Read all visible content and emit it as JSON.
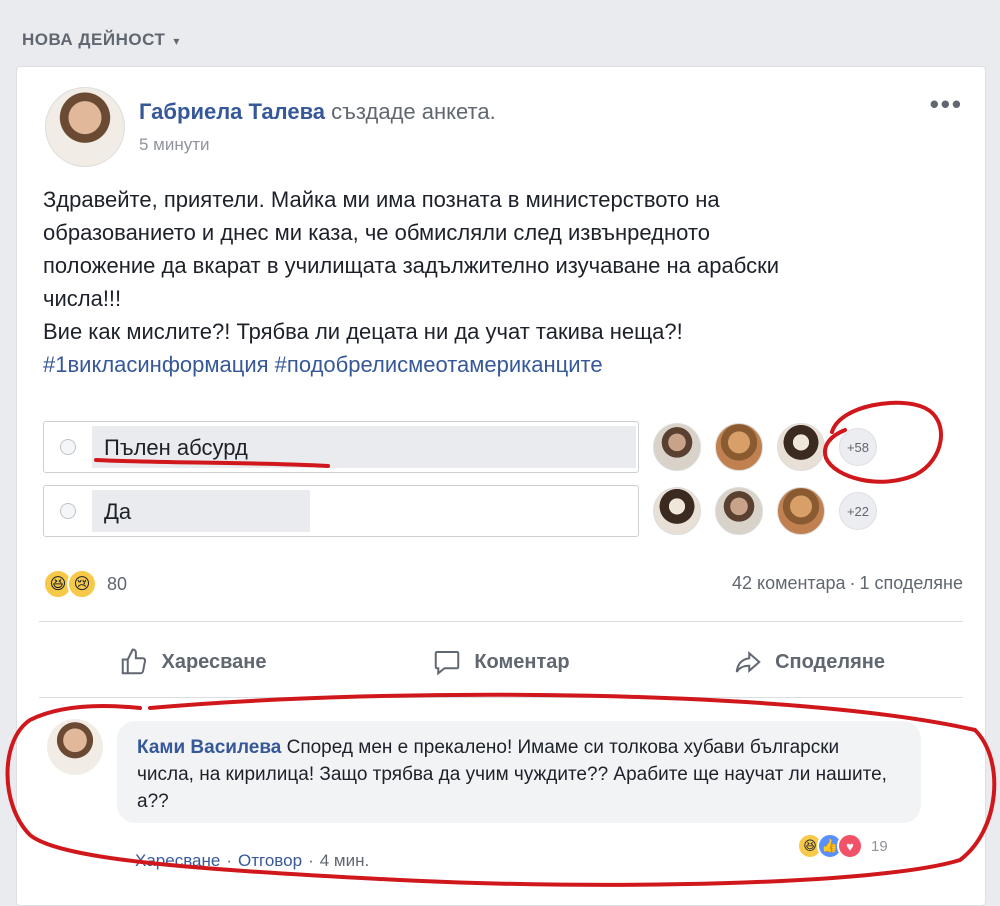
{
  "feed": {
    "section_title": "НОВА ДЕЙНОСТ",
    "caret": "▾"
  },
  "post": {
    "author": "Габриела Талева",
    "action": "създаде анкета.",
    "time": "5 минути",
    "more": "•••",
    "text_lines": [
      "Здравейте, приятели. Майка ми има позната в министерството на",
      "образованието и днес ми каза, че обмисляли след извънредното",
      "положение да вкарат в училищата задължително изучаване на арабски",
      "числа!!!",
      "Вие как мислите?! Трябва ли децата ни да учат такива неща?!"
    ],
    "hashtags": "#1викласинформация #подобрелисмеотамериканците"
  },
  "poll": {
    "options": [
      {
        "label": "Пълен абсурд",
        "more_voters": "+58",
        "share": 1.0
      },
      {
        "label": "Да",
        "more_voters": "+22",
        "share": 0.4
      }
    ]
  },
  "engagement": {
    "reaction_count": "80",
    "comments": "42 коментара",
    "shares": "1 споделяне",
    "separator": "·"
  },
  "actions": {
    "like": "Харесване",
    "comment": "Коментар",
    "share": "Споделяне"
  },
  "comment": {
    "author": "Ками Василева",
    "text": "Според мен е прекалено! Имаме си толкова хубави български числа, на кирилица! Защо трябва да учим чуждите?? Арабите ще научат ли нашите, а??",
    "reaction_count": "19",
    "like_link": "Харесване",
    "reply_link": "Отговор",
    "time": "4 мин.",
    "separator": "·"
  },
  "icons": [
    "caret-down-icon",
    "haha-icon",
    "sad-icon",
    "like-icon",
    "love-icon",
    "thumbs-up-outline-icon",
    "speech-bubble-icon",
    "share-arrow-icon"
  ],
  "annotation_color": "#d0171b"
}
